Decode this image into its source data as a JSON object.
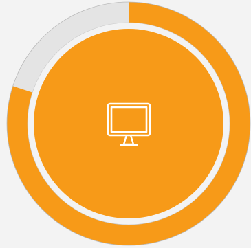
{
  "progress_ring": {
    "value_fraction": 0.8,
    "start_angle_deg": 0,
    "colors": {
      "background": "#f3f3f3",
      "track": "#e4e4e4",
      "progress": "#f79a18",
      "inner_circle": "#f79a18",
      "icon": "#ffffff",
      "outline": "#b9b9b9"
    }
  },
  "center_icon": {
    "name": "monitor-icon"
  }
}
